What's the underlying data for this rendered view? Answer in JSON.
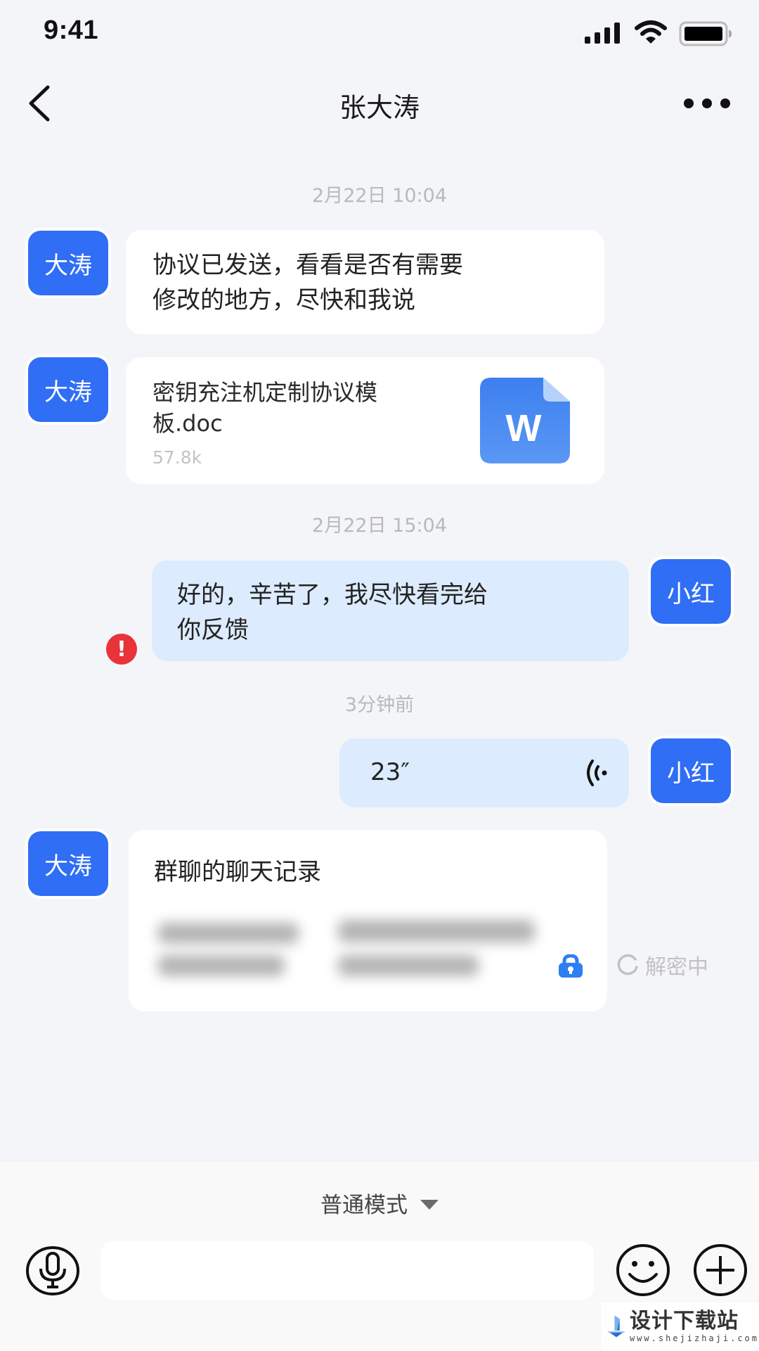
{
  "status_bar": {
    "time": "9:41",
    "icons": [
      "signal-icon",
      "wifi-icon",
      "battery-icon"
    ]
  },
  "nav": {
    "title": "张大涛",
    "back_icon": "chevron-left-icon",
    "more_icon": "more-dots-icon"
  },
  "colors": {
    "accent": "#2f6ef5",
    "sent_bubble": "#dcebfd",
    "received_bubble": "#ffffff",
    "background": "#f4f5f9",
    "error": "#e8333a",
    "timestamp": "#b9b9bd"
  },
  "messages": [
    {
      "type": "timestamp",
      "text": "2月22日 10:04"
    },
    {
      "type": "text",
      "direction": "received",
      "avatar": "大涛",
      "lines": [
        "协议已发送，看看是否有需要",
        "修改的地方，尽快和我说"
      ]
    },
    {
      "type": "file",
      "direction": "received",
      "avatar": "大涛",
      "name_lines": [
        "密钥充注机定制协议模",
        "板.doc"
      ],
      "size": "57.8k",
      "file_icon_letter": "W"
    },
    {
      "type": "timestamp",
      "text": "2月22日 15:04"
    },
    {
      "type": "text",
      "direction": "sent",
      "avatar": "小红",
      "status": "failed",
      "lines": [
        "好的，辛苦了，我尽快看完给",
        "你反馈"
      ],
      "error_glyph": "!"
    },
    {
      "type": "timestamp",
      "text": "3分钟前"
    },
    {
      "type": "voice",
      "direction": "sent",
      "avatar": "小红",
      "duration": "23″"
    },
    {
      "type": "chat_record",
      "direction": "received",
      "avatar": "大涛",
      "title": "群聊的聊天记录",
      "decrypt_status": "解密中"
    }
  ],
  "composer": {
    "mode_label": "普通模式",
    "input_value": "",
    "input_placeholder": "",
    "voice_icon": "microphone-icon",
    "emoji_icon": "smiley-icon",
    "add_icon": "plus-icon"
  },
  "watermark": {
    "title": "设计下载站",
    "url": "www.shejizhaji.com"
  }
}
